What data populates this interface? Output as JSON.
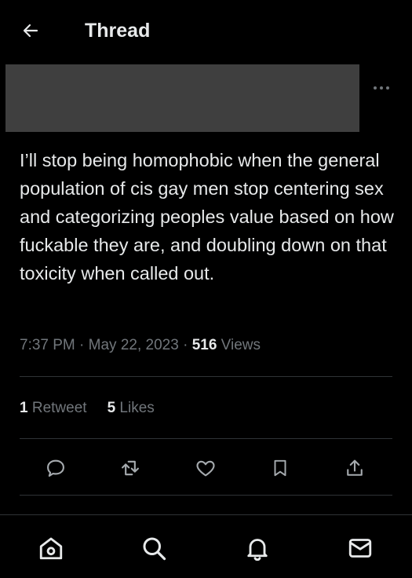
{
  "header": {
    "back_icon": "arrow-left-icon",
    "title": "Thread"
  },
  "author": {
    "redacted": true,
    "more_icon": "more-horizontal-icon"
  },
  "tweet": {
    "text": "I’ll stop being homophobic when the general population of cis gay men stop centering sex and categorizing peoples value based on how fuckable they are, and doubling down on that toxicity when called out.",
    "time": "7:37 PM",
    "separator": "·",
    "date": "May 22, 2023",
    "views_count": "516",
    "views_label": "Views"
  },
  "stats": {
    "retweets_count": "1",
    "retweets_label": "Retweet",
    "likes_count": "5",
    "likes_label": "Likes"
  },
  "actions": [
    {
      "name": "reply",
      "icon": "comment-icon"
    },
    {
      "name": "retweet",
      "icon": "retweet-icon"
    },
    {
      "name": "like",
      "icon": "heart-icon"
    },
    {
      "name": "bookmark",
      "icon": "bookmark-icon"
    },
    {
      "name": "share",
      "icon": "share-icon"
    }
  ],
  "bottom_nav": [
    {
      "name": "home",
      "icon": "home-icon"
    },
    {
      "name": "search",
      "icon": "search-icon"
    },
    {
      "name": "notifications",
      "icon": "bell-icon"
    },
    {
      "name": "messages",
      "icon": "mail-icon"
    }
  ],
  "colors": {
    "background": "#000000",
    "text_primary": "#e7e9ea",
    "text_secondary": "#71767b",
    "divider": "#2f3336",
    "redaction": "#3f3f3f"
  }
}
